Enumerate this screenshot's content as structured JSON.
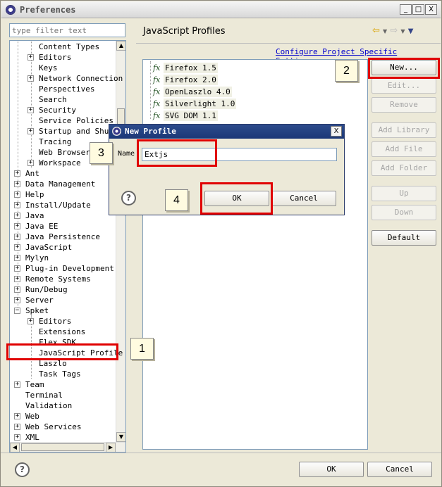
{
  "window": {
    "title": "Preferences",
    "controls": [
      "_",
      "□",
      "X"
    ]
  },
  "filter": {
    "placeholder": "type filter text"
  },
  "tree": [
    {
      "label": "Content Types",
      "expandable": false
    },
    {
      "label": "Editors",
      "expandable": true
    },
    {
      "label": "Keys",
      "expandable": false
    },
    {
      "label": "Network Connection",
      "expandable": true
    },
    {
      "label": "Perspectives",
      "expandable": false
    },
    {
      "label": "Search",
      "expandable": false
    },
    {
      "label": "Security",
      "expandable": true
    },
    {
      "label": "Service Policies",
      "expandable": false
    },
    {
      "label": "Startup and Shut",
      "expandable": true
    },
    {
      "label": "Tracing",
      "expandable": false
    },
    {
      "label": "Web Browser",
      "expandable": false
    },
    {
      "label": "Workspace",
      "expandable": true
    },
    {
      "label": "Ant",
      "expandable": true
    },
    {
      "label": "Data Management",
      "expandable": true
    },
    {
      "label": "Help",
      "expandable": true
    },
    {
      "label": "Install/Update",
      "expandable": true
    },
    {
      "label": "Java",
      "expandable": true
    },
    {
      "label": "Java EE",
      "expandable": true
    },
    {
      "label": "Java Persistence",
      "expandable": true
    },
    {
      "label": "JavaScript",
      "expandable": true
    },
    {
      "label": "Mylyn",
      "expandable": true
    },
    {
      "label": "Plug-in Development",
      "expandable": true
    },
    {
      "label": "Remote Systems",
      "expandable": true
    },
    {
      "label": "Run/Debug",
      "expandable": true
    },
    {
      "label": "Server",
      "expandable": true
    },
    {
      "label": "Spket",
      "expandable": true
    },
    {
      "label": "Editors",
      "expandable": true
    },
    {
      "label": "Extensions",
      "expandable": false
    },
    {
      "label": "Flex SDK",
      "expandable": false
    },
    {
      "label": "JavaScript Profile",
      "expandable": false
    },
    {
      "label": "Laszlo",
      "expandable": false
    },
    {
      "label": "Task Tags",
      "expandable": false
    },
    {
      "label": "Team",
      "expandable": true
    },
    {
      "label": "Terminal",
      "expandable": false
    },
    {
      "label": "Validation",
      "expandable": false
    },
    {
      "label": "Web",
      "expandable": true
    },
    {
      "label": "Web Services",
      "expandable": true
    },
    {
      "label": "XML",
      "expandable": true
    }
  ],
  "page": {
    "title": "JavaScript Profiles",
    "config_link": "Configure Project Specific Settings...",
    "profiles": [
      "Firefox 1.5",
      "Firefox 2.0",
      "OpenLaszlo 4.0",
      "Silverlight 1.0",
      "SVG DOM 1.1"
    ],
    "profile_icon": "fx",
    "buttons": {
      "new": "New...",
      "edit": "Edit...",
      "remove": "Remove",
      "add_library": "Add Library",
      "add_file": "Add File",
      "add_folder": "Add Folder",
      "up": "Up",
      "down": "Down",
      "default": "Default"
    }
  },
  "footer": {
    "help": "?",
    "ok": "OK",
    "cancel": "Cancel"
  },
  "dialog": {
    "title": "New Profile",
    "close": "X",
    "name_label": "Name",
    "name_value": "Extjs",
    "help": "?",
    "ok": "OK",
    "cancel": "Cancel"
  },
  "callouts": [
    "1",
    "2",
    "3",
    "4"
  ],
  "colors": {
    "highlight": "#e00000",
    "link": "#0000cc",
    "dialog_title": "#1b3777"
  }
}
